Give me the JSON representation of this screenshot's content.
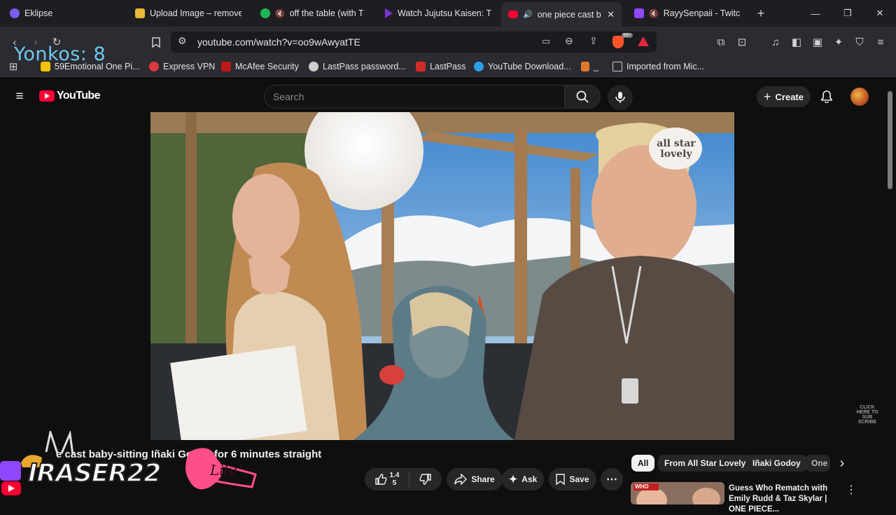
{
  "browser": {
    "tabs": [
      {
        "label": "Eklipse",
        "color": "#7b5cf0"
      },
      {
        "label": "Upload Image – remove",
        "color": "#e9b93a"
      },
      {
        "label": "off the table (with Th",
        "color": "#1db954"
      },
      {
        "label": "Watch Jujutsu Kaisen: Th",
        "color": "#7b32d8"
      },
      {
        "label": "one piece cast b",
        "color": "#ff0033"
      },
      {
        "label": "RayySenpaii - Twitch",
        "color": "#9146ff"
      }
    ],
    "new_tab": "+",
    "url": "youtube.com/watch?v=oo9wAwyatTE",
    "brave_badge": "99+",
    "bookmarks": [
      {
        "label": "59Emotional One Pi...",
        "color": "#f2c200"
      },
      {
        "label": "Express VPN",
        "color": "#da3940"
      },
      {
        "label": "McAfee Security",
        "color": "#c01818"
      },
      {
        "label": "LastPass password...",
        "color": "#cfcfcf"
      },
      {
        "label": "LastPass",
        "color": "#d32d27"
      },
      {
        "label": "YouTube Download...",
        "color": "#2aa0e8"
      },
      {
        "label": "_",
        "color": "#e07a2a"
      },
      {
        "label": "Imported from Mic...",
        "color": "#cfcfcf"
      }
    ]
  },
  "overlay": {
    "yonkos": "Yonkos: 8",
    "streamer_name": "IRASER22",
    "signature": "Lily",
    "corner_watermark": "CLICK HERE TO SUB SCRIBE"
  },
  "youtube": {
    "logo_text": "YouTube",
    "search_placeholder": "Search",
    "create_label": "Create",
    "video": {
      "watermark": "all star lovely",
      "title": "e cast baby-sitting Iñaki Godoy for 6 minutes straight",
      "like_count": "1.4",
      "like_count_sub": "5",
      "share_label": "Share",
      "ask_label": "Ask",
      "save_label": "Save"
    },
    "chips": [
      "All",
      "From All Star Lovely",
      "Iñaki Godoy",
      "One"
    ],
    "recommendation": {
      "title": "Guess Who Rematch with Emily Rudd & Taz Skylar | ONE PIECE...",
      "thumb_text": "WHO"
    }
  }
}
